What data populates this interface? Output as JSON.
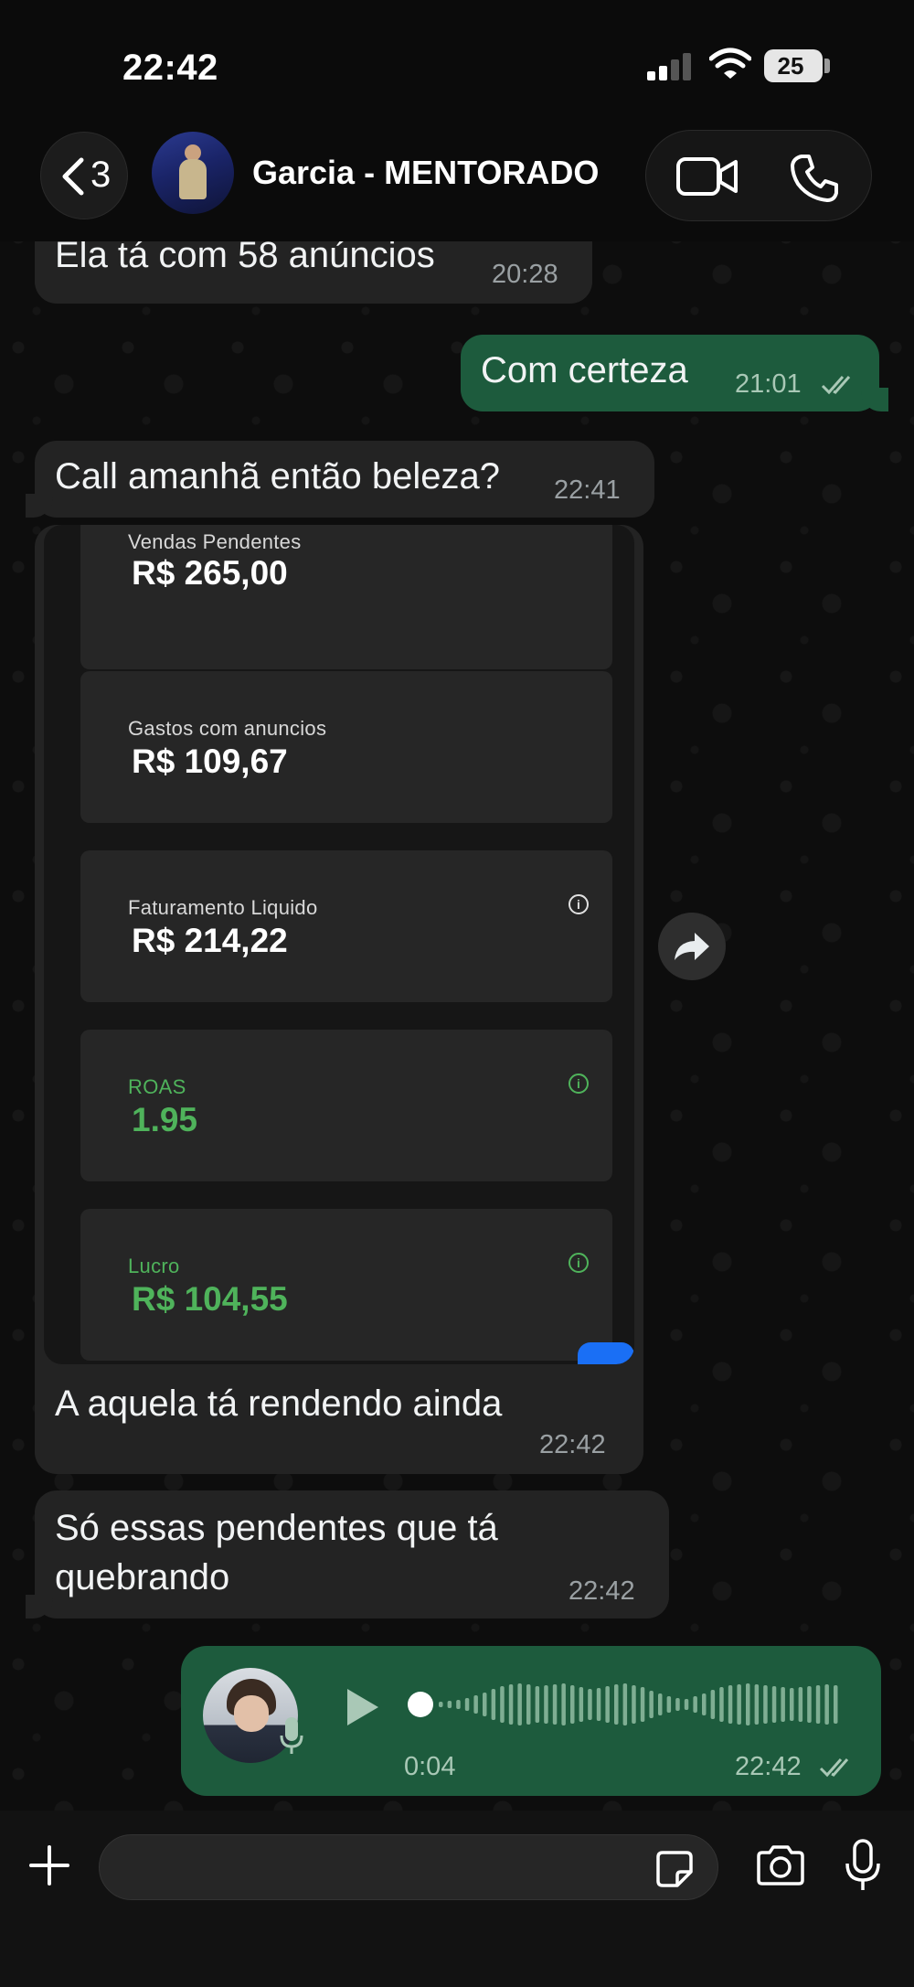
{
  "status_bar": {
    "time": "22:42",
    "battery": "25"
  },
  "header": {
    "back_count": "3",
    "contact_name": "Garcia - MENTORADO"
  },
  "messages": [
    {
      "text": "Ela tá com 58 anúncios",
      "time": "20:28",
      "direction": "in"
    },
    {
      "text": "Com certeza",
      "time": "21:01",
      "direction": "out",
      "status": "read"
    },
    {
      "text": "Call amanhã então beleza?",
      "time": "22:41",
      "direction": "in"
    }
  ],
  "image_message": {
    "cards": [
      {
        "label": "Vendas Pendentes",
        "value": "R$ 265,00",
        "info": false,
        "color": "#ffffff"
      },
      {
        "label": "Gastos com anuncios",
        "value": "R$ 109,67",
        "info": false,
        "color": "#ffffff"
      },
      {
        "label": "Faturamento Liquido",
        "value": "R$ 214,22",
        "info": true,
        "color": "#ffffff"
      },
      {
        "label": "ROAS",
        "value": "1.95",
        "info": true,
        "color": "#4fb35b"
      },
      {
        "label": "Lucro",
        "value": "R$ 104,55",
        "info": true,
        "color": "#4fb35b"
      }
    ],
    "info_glyph": "i",
    "caption": "A aquela tá rendendo ainda",
    "time": "22:42"
  },
  "message_multiline": {
    "lines": [
      "Só essas pendentes que tá",
      "quebrando"
    ],
    "time": "22:42"
  },
  "voice_message": {
    "duration": "0:04",
    "time": "22:42",
    "status": "read"
  },
  "colors": {
    "outgoing_bubble": "#1d5b3d",
    "incoming_bubble": "#232323",
    "accent_green": "#4fb35b"
  },
  "icons": {
    "back": "chevron-left-icon",
    "video": "video-camera-icon",
    "phone": "phone-icon",
    "forward": "forward-arrow-icon",
    "play": "play-icon",
    "plus": "plus-icon",
    "sticker": "sticker-icon",
    "camera": "camera-icon",
    "mic": "microphone-icon"
  }
}
